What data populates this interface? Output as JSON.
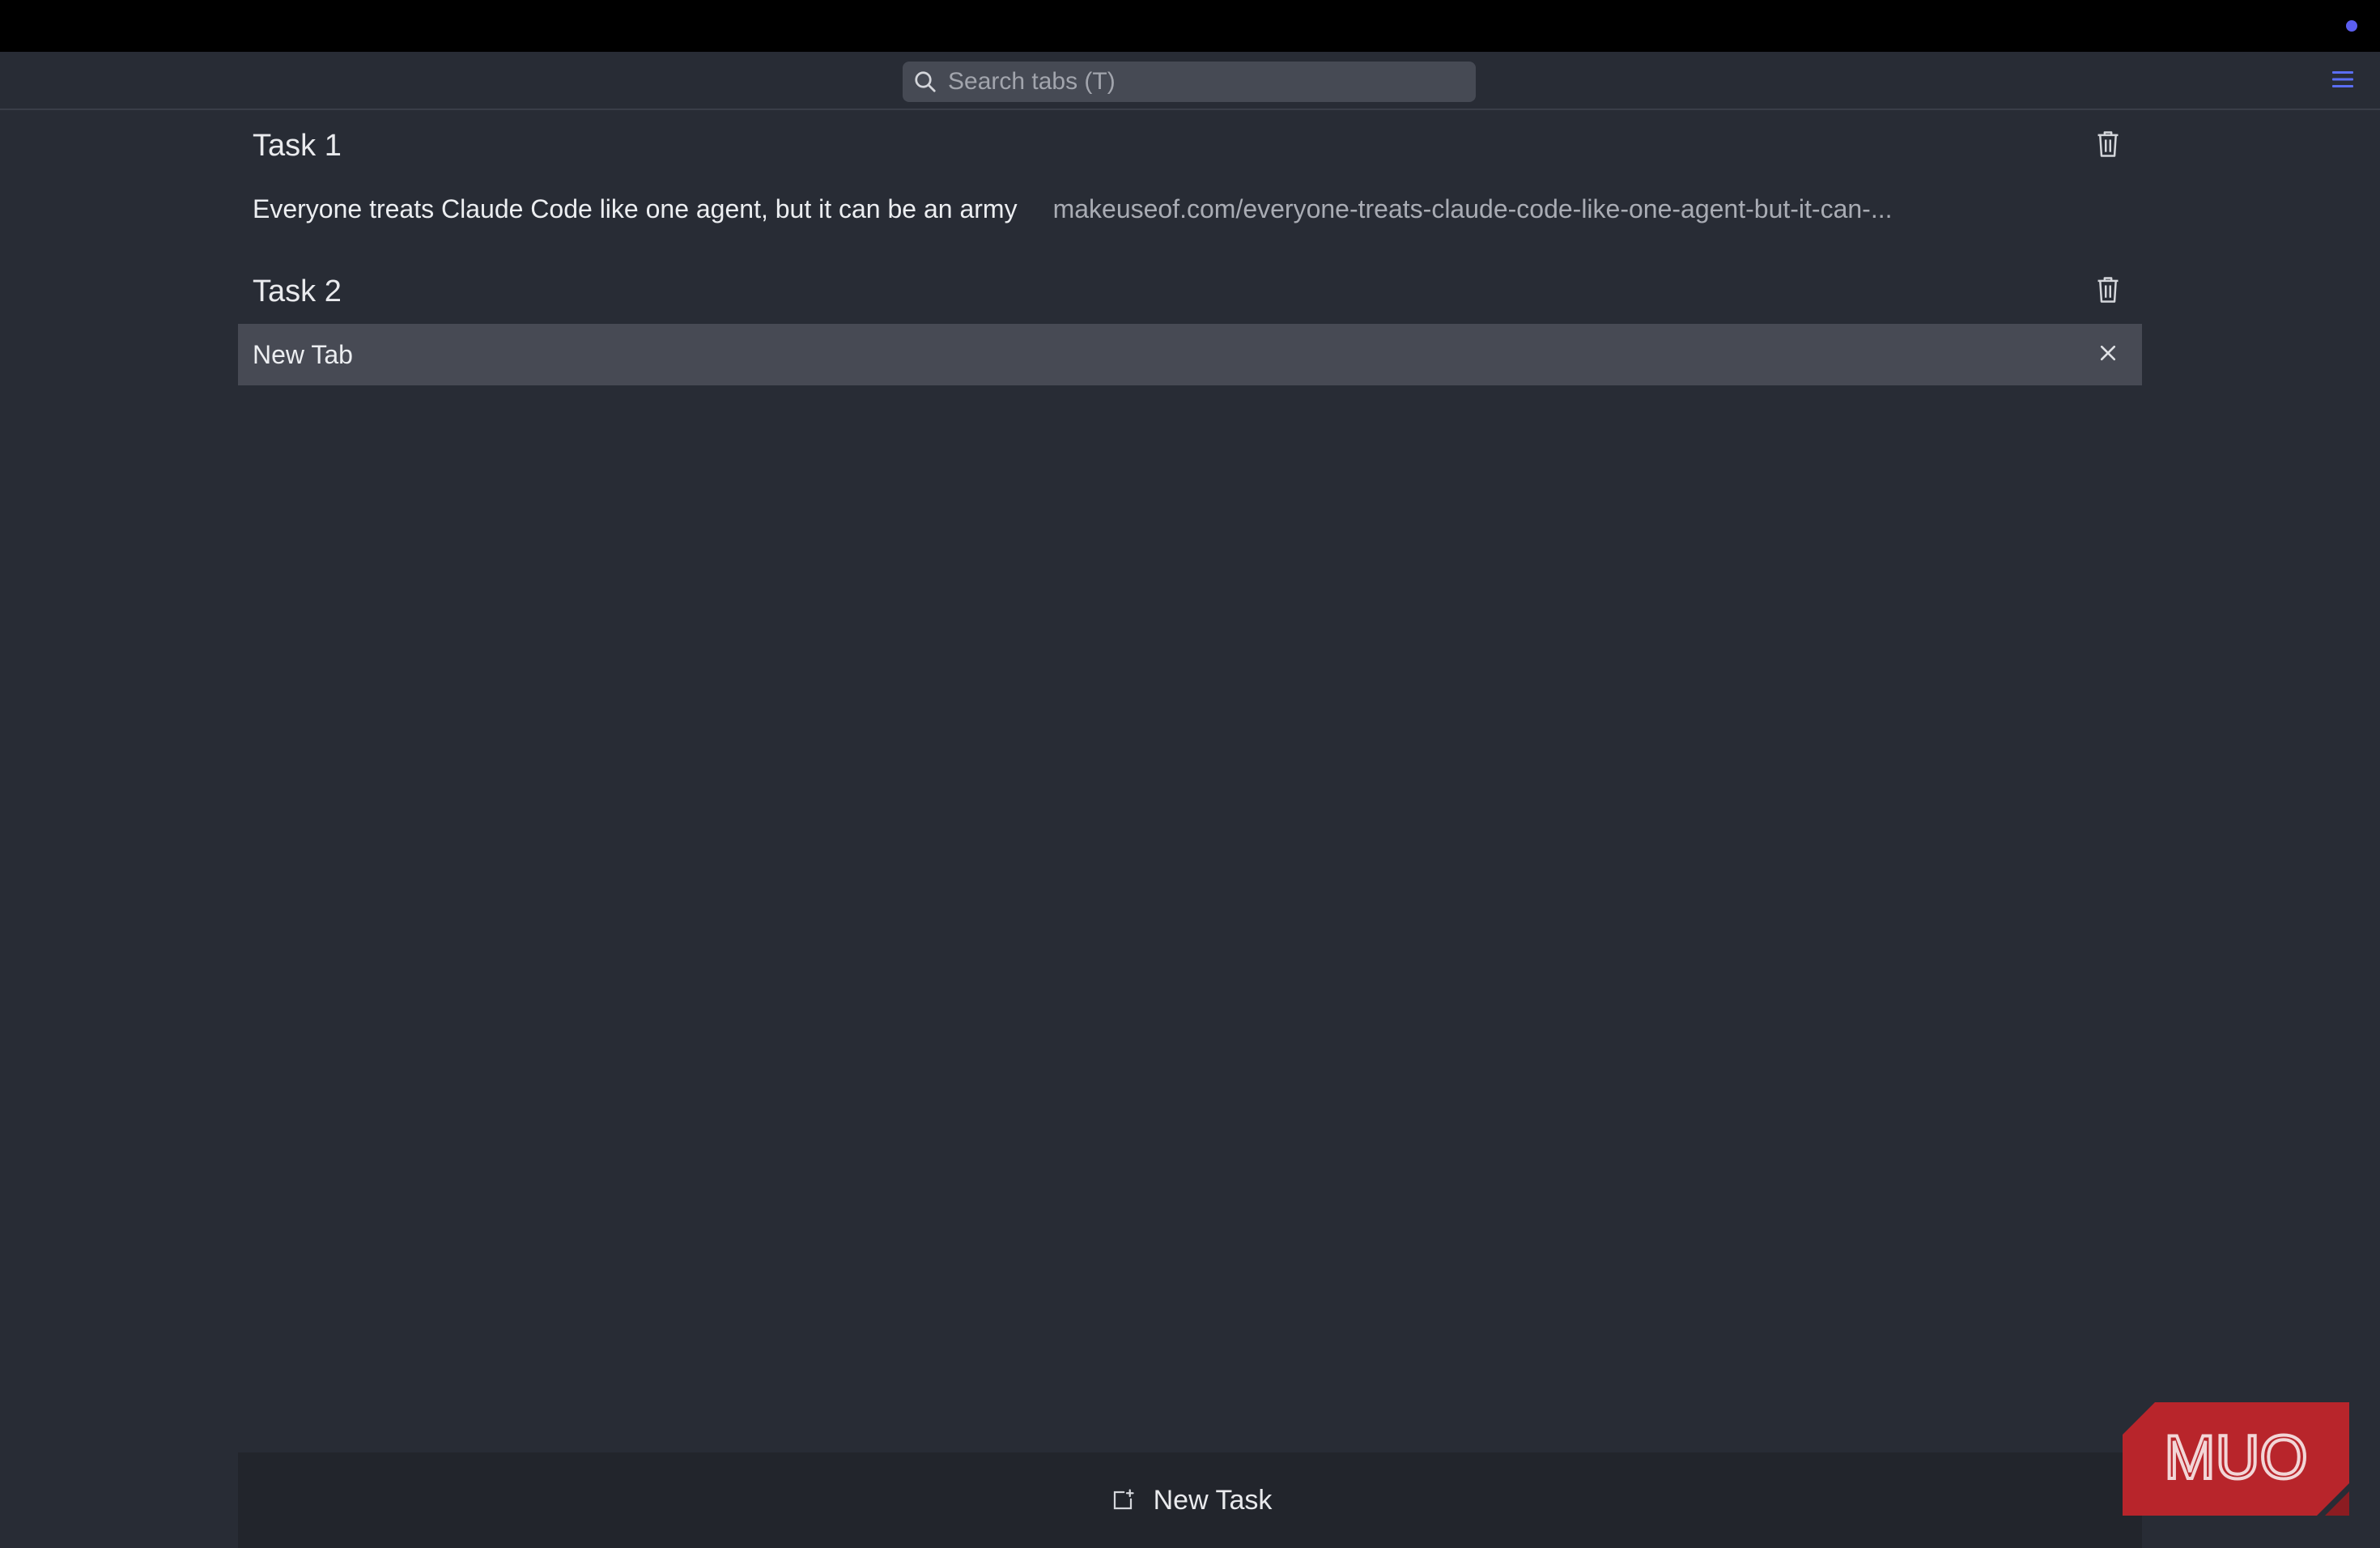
{
  "search": {
    "placeholder": "Search tabs (T)",
    "value": ""
  },
  "tasks": [
    {
      "title": "Task 1",
      "tabs": [
        {
          "title": "Everyone treats Claude Code like one agent, but it can be an army",
          "url": "makeuseof.com/everyone-treats-claude-code-like-one-agent-but-it-can-..."
        }
      ]
    },
    {
      "title": "Task 2",
      "tabs": [
        {
          "title": "New Tab",
          "url": ""
        }
      ]
    }
  ],
  "footer": {
    "new_task_label": "New Task"
  },
  "watermark": {
    "text": "MUO"
  },
  "colors": {
    "background": "#282c35",
    "topbar": "#000000",
    "accent": "#5b5ef0",
    "selected_row": "#474a54",
    "logo_red": "#b8252b"
  }
}
